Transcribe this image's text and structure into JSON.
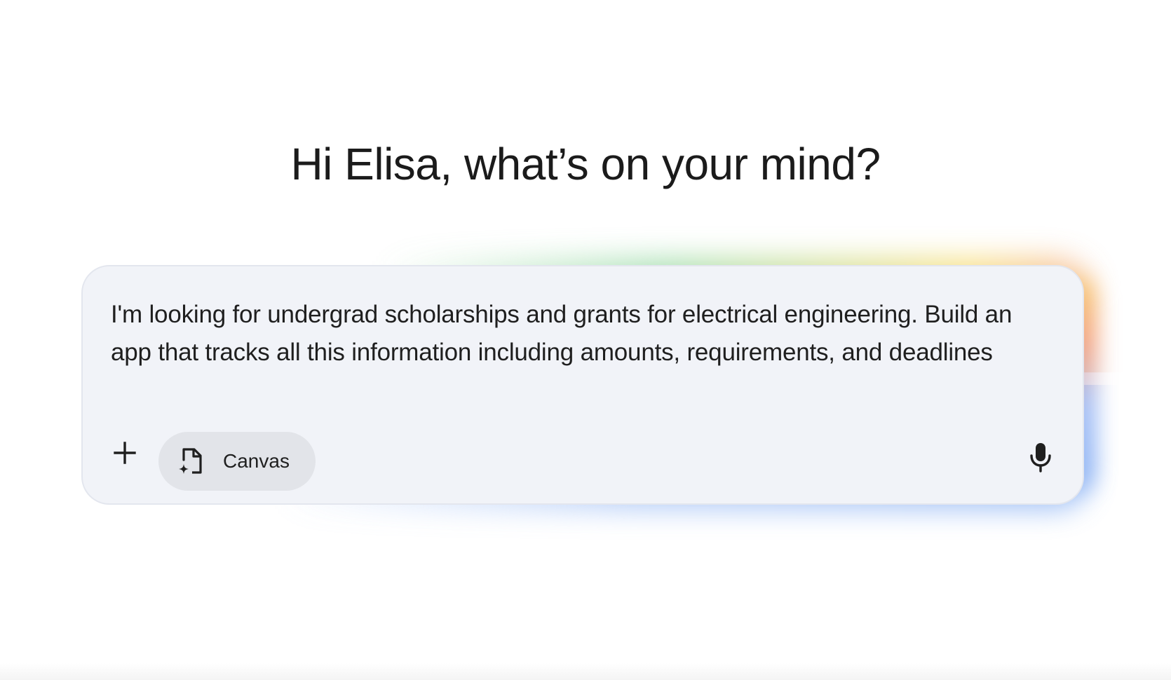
{
  "greeting": "Hi Elisa, what’s on your mind?",
  "prompt": {
    "text": "I'm looking for undergrad scholarships and grants for electrical engineering. Build an app that tracks all this information including amounts, requirements, and deadlines"
  },
  "toolbar": {
    "add_icon": "plus-icon",
    "canvas_label": "Canvas",
    "canvas_icon": "canvas-document-sparkle-icon",
    "mic_icon": "microphone-icon"
  },
  "colors": {
    "glow_green": "#7fd08e",
    "glow_yellow": "#f5d34c",
    "glow_red": "#f08a6a",
    "glow_blue": "#7aa7f2",
    "box_background": "#f1f3f8",
    "chip_background": "#e2e4e9"
  }
}
